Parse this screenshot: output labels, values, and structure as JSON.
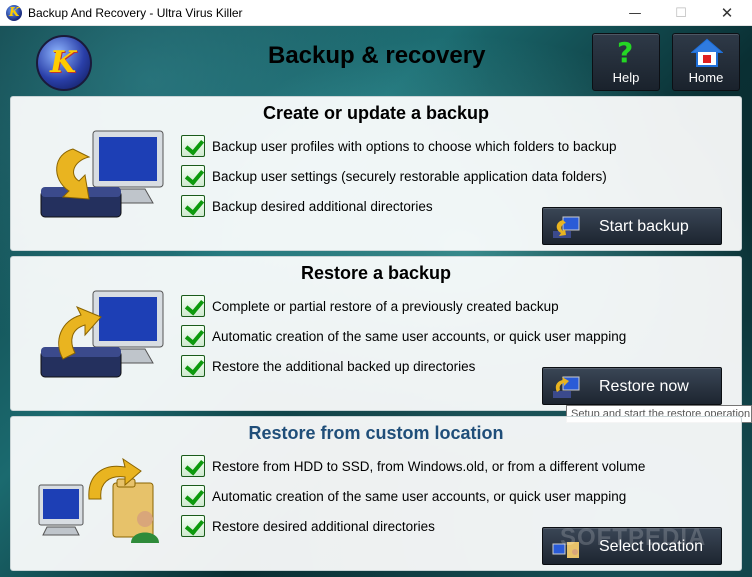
{
  "window": {
    "title": "Backup And Recovery - Ultra Virus Killer",
    "min": "—",
    "max": "☐",
    "close": "✕"
  },
  "header": {
    "logo_text": "K",
    "title": "Backup & recovery",
    "help_label": "Help",
    "home_label": "Home"
  },
  "panels": [
    {
      "title": "Create or update a backup",
      "features": [
        "Backup user profiles with options to choose which folders to backup",
        "Backup user settings (securely restorable application data folders)",
        "Backup desired additional directories"
      ],
      "button": "Start backup"
    },
    {
      "title": "Restore a backup",
      "features": [
        "Complete or partial restore of a previously created backup",
        "Automatic creation of the same user accounts, or quick user mapping",
        "Restore the additional backed up directories"
      ],
      "button": "Restore now"
    },
    {
      "title": "Restore from custom location",
      "features": [
        "Restore from HDD to SSD, from Windows.old, or from a different volume",
        "Automatic creation of the same user accounts, or quick user mapping",
        "Restore desired additional directories"
      ],
      "button": "Select location"
    }
  ],
  "tooltip": "Setup and start the restore operation",
  "watermark": "SOFTPEDIA",
  "colors": {
    "accent_check": "#0e9a0e",
    "help_icon": "#24d624",
    "custom_title": "#1f4e79"
  }
}
